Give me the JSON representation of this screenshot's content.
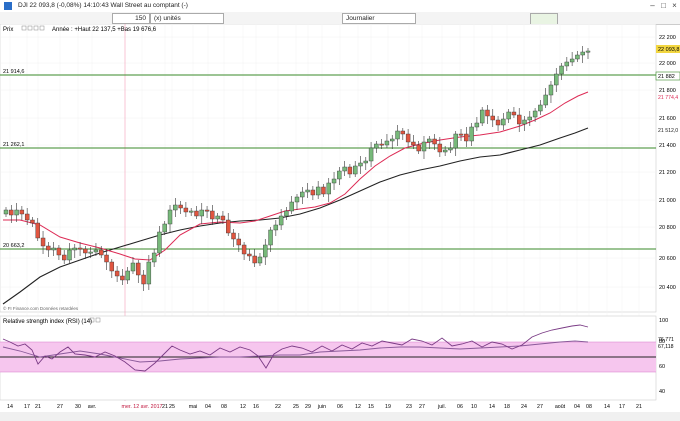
{
  "window": {
    "title": "DJI   22 093,8 (-0,08%) 14:10:43 Wall Street au comptant (-)"
  },
  "toolbar": {
    "count": "150",
    "units": "(x) unités",
    "period": "Journalier"
  },
  "chart": {
    "prix_label": "Prix",
    "info_line": "Année : +Haut 22 137,5 +Bas 19 676,6",
    "price_ticks": [
      "22 200",
      "22 000",
      "21 800",
      "21 600",
      "21 400",
      "21 200",
      "21 000",
      "20 800",
      "20 600",
      "20 400"
    ],
    "tag_current": "22 093,8",
    "tag_level1": "21 882",
    "tag_ma1": "21 774,4",
    "tag_ma2": "21 512,0",
    "level_labels": [
      "21 914,6",
      "21 262,1",
      "20 663,2"
    ],
    "source": "© FI Finance.com Données retardées",
    "rsi_title": "Relative strength index (RSI) (14)",
    "rsi_ticks": [
      "100",
      "80",
      "60",
      "40"
    ],
    "rsi_tag1": "76,771",
    "rsi_tag2": "67,118",
    "x_labels": [
      "14",
      "17",
      "21",
      "27",
      "30",
      "avr.",
      "mer. 12 avr. 2017",
      "21",
      "25",
      "mai",
      "04",
      "08",
      "12",
      "16",
      "22",
      "25",
      "29",
      "juin",
      "06",
      "12",
      "15",
      "19",
      "23",
      "27",
      "juil.",
      "06",
      "10",
      "14",
      "18",
      "24",
      "27",
      "août",
      "04",
      "08",
      "14",
      "17",
      "21"
    ],
    "colors": {
      "up": "#77b97a",
      "down": "#e05540",
      "ma_fast": "#dd2b55",
      "ma_slow": "#222222",
      "level": "#3a8a2a",
      "rsi_band": "#f6c6ee",
      "current_tag": "#f2d640"
    }
  }
}
